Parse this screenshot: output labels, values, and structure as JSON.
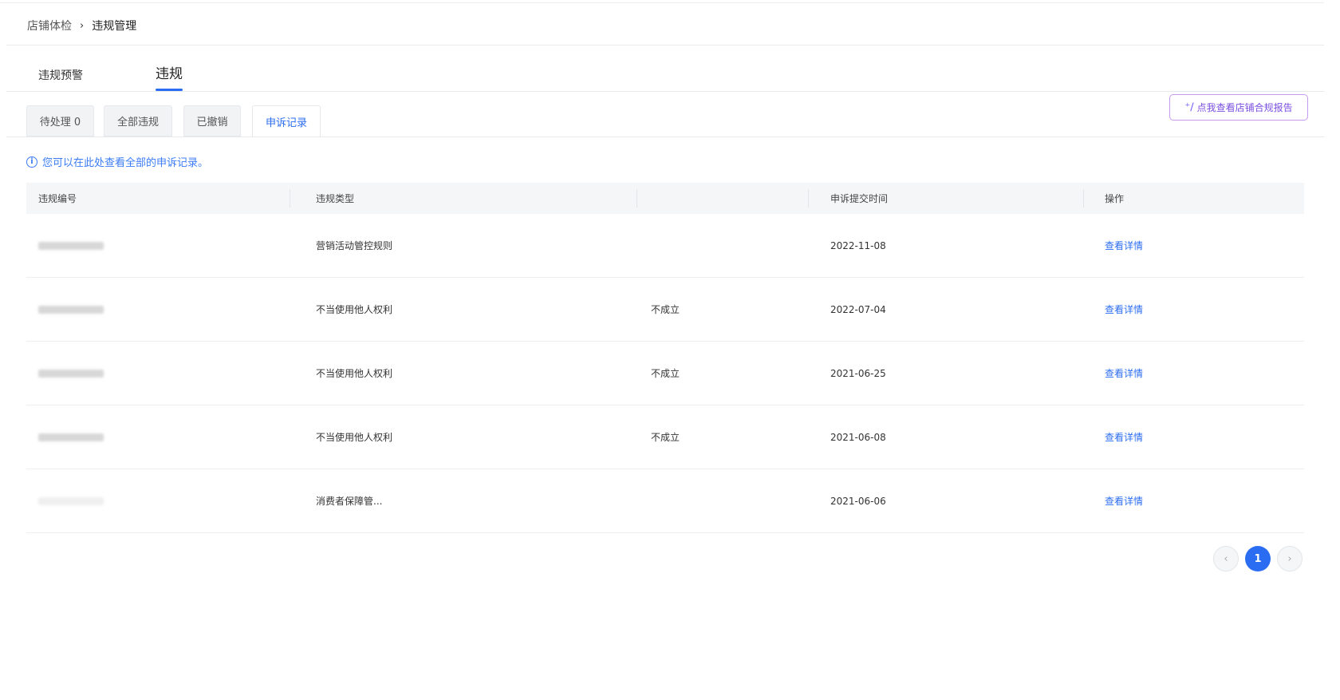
{
  "breadcrumb": {
    "parent": "店铺体检",
    "separator": "›",
    "current": "违规管理"
  },
  "main_tabs": [
    {
      "label": "违规预警"
    },
    {
      "label": "违规"
    }
  ],
  "sub_tabs": [
    {
      "label": "待处理 0"
    },
    {
      "label": "全部违规"
    },
    {
      "label": "已撤销"
    },
    {
      "label": "申诉记录"
    }
  ],
  "report_button": {
    "icon": "sparkle-icon",
    "label": "点我查看店铺合规报告"
  },
  "notice": {
    "icon": "info-icon",
    "text": "您可以在此处查看全部的申诉记录。"
  },
  "table": {
    "headers": [
      "违规编号",
      "违规类型",
      "",
      "申诉提交时间",
      "操作"
    ],
    "rows": [
      {
        "type": "营销活动管控规则",
        "result": "",
        "date": "2022-11-08",
        "action": "查看详情"
      },
      {
        "type": "不当使用他人权利",
        "result": "不成立",
        "date": "2022-07-04",
        "action": "查看详情"
      },
      {
        "type": "不当使用他人权利",
        "result": "不成立",
        "date": "2021-06-25",
        "action": "查看详情"
      },
      {
        "type": "不当使用他人权利",
        "result": "不成立",
        "date": "2021-06-08",
        "action": "查看详情"
      },
      {
        "type": "消费者保障管...",
        "result": "",
        "date": "2021-06-06",
        "action": "查看详情"
      }
    ]
  },
  "pagination": {
    "prev": "‹",
    "current": "1",
    "next": "›"
  },
  "colors": {
    "accent": "#2b6df2",
    "report_border": "#c69af1",
    "report_text": "#7a4fe0"
  }
}
